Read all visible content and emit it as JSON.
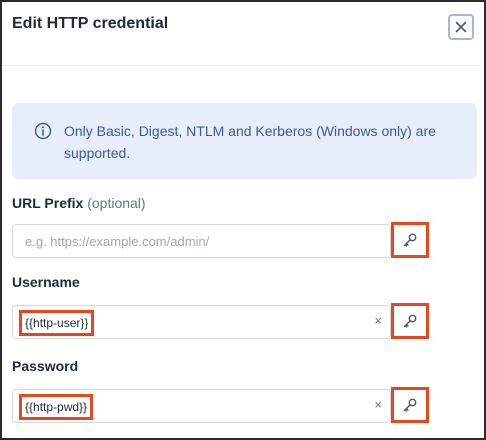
{
  "dialog": {
    "title": "Edit HTTP credential"
  },
  "info": {
    "text": "Only Basic, Digest, NTLM and Kerberos (Windows only) are supported.",
    "icon": "info-circle-icon"
  },
  "url_prefix": {
    "label": "URL Prefix",
    "optional": "(optional)",
    "placeholder": "e.g. https://example.com/admin/"
  },
  "username": {
    "label": "Username",
    "value": "{{http-user}}",
    "clear": "×"
  },
  "password": {
    "label": "Password",
    "value": "{{http-pwd}}",
    "clear": "×"
  },
  "colors": {
    "highlight": "#e8461e",
    "info_bg": "#e8eef9",
    "info_text": "#3a5a9b"
  }
}
